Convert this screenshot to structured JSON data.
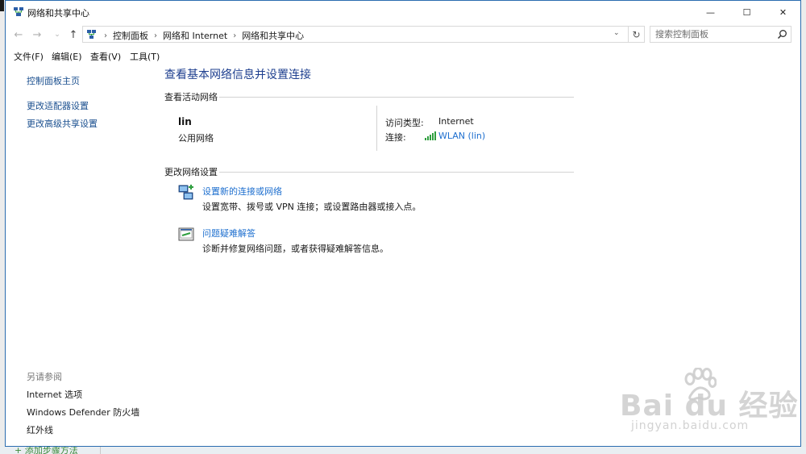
{
  "window": {
    "title": "网络和共享中心",
    "minimize_glyph": "—",
    "maximize_glyph": "☐",
    "close_glyph": "✕"
  },
  "navigation": {
    "back_glyph": "←",
    "forward_glyph": "→",
    "recent_glyph": "⌄",
    "up_glyph": "↑",
    "breadcrumbs": [
      "控制面板",
      "网络和 Internet",
      "网络和共享中心"
    ],
    "separator": "›",
    "dropdown_glyph": "⌄",
    "refresh_glyph": "↻",
    "search_placeholder": "搜索控制面板"
  },
  "menu": {
    "items": [
      "文件(F)",
      "编辑(E)",
      "查看(V)",
      "工具(T)"
    ]
  },
  "sidebar": {
    "home": "控制面板主页",
    "links": [
      "更改适配器设置",
      "更改高级共享设置"
    ],
    "see_also_heading": "另请参阅",
    "see_also": [
      "Internet 选项",
      "Windows Defender 防火墙",
      "红外线"
    ]
  },
  "main": {
    "title": "查看基本网络信息并设置连接",
    "active_networks_heading": "查看活动网络",
    "network": {
      "name": "lin",
      "category": "公用网络",
      "access_type_label": "访问类型:",
      "access_type_value": "Internet",
      "connections_label": "连接:",
      "connection_link": "WLAN (lin)"
    },
    "change_settings_heading": "更改网络设置",
    "tasks": [
      {
        "link": "设置新的连接或网络",
        "description": "设置宽带、拨号或 VPN 连接；或设置路由器或接入点。",
        "icon": "new-connection-icon"
      },
      {
        "link": "问题疑难解答",
        "description": "诊断并修复网络问题，或者获得疑难解答信息。",
        "icon": "troubleshoot-icon"
      }
    ]
  },
  "taskbar_fragment": {
    "text": "+ 添加步骤方法"
  },
  "watermark": {
    "main": "Bai  du 经验",
    "sub": "jingyan.baidu.com"
  },
  "colors": {
    "link": "#1e6fcf",
    "title": "#1e3f8f",
    "window_border": "#2b6cb0",
    "signal": "#2e9e3e"
  }
}
